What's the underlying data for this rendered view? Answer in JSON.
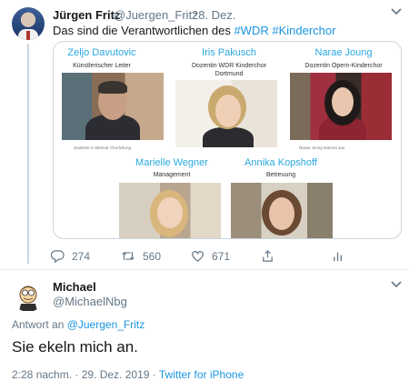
{
  "tweet": {
    "name": "Jürgen Fritz",
    "handle": "@Juergen_Fritz",
    "dot": "·",
    "date": "28. Dez.",
    "text_prefix": "Das sind die Verantwortlichen des ",
    "hashtag1": "#WDR",
    "hashtag2": "#Kinderchor",
    "actions": {
      "replies": "274",
      "retweets": "560",
      "likes": "671"
    }
  },
  "image": {
    "people": [
      {
        "name": "Zeljo Davutovic",
        "role": "Künstlerischer Leiter",
        "caption": "studierte in Weimar Chorleitung"
      },
      {
        "name": "Iris Pakusch",
        "role": "Dozentin WDR Kinderchor",
        "role2": "Dortmund"
      },
      {
        "name": "Narae Joung",
        "role": "Dozentin Opern-Kinderchor",
        "caption": "Narae Joung stammt aus"
      },
      {
        "name": "Marielle Wegner",
        "role": "Management"
      },
      {
        "name": "Annika Kopshoff",
        "role": "Betreuung"
      }
    ]
  },
  "reply_tweet": {
    "name": "Michael",
    "handle": "@MichaelNbg",
    "reply_to_prefix": "Antwort an ",
    "reply_to_handle": "@Juergen_Fritz",
    "text": "Sie ekeln mich an.",
    "timestamp": "2:28 nachm. · 29. Dez. 2019 · ",
    "source": "Twitter for iPhone"
  },
  "colors": {
    "link": "#1b95e0",
    "muted": "#657786",
    "border": "#ccd6dd",
    "name_accent": "#2aa8e0"
  },
  "icons": [
    "reply-icon",
    "retweet-icon",
    "like-icon",
    "share-icon",
    "analytics-icon",
    "chevron-down-icon"
  ]
}
